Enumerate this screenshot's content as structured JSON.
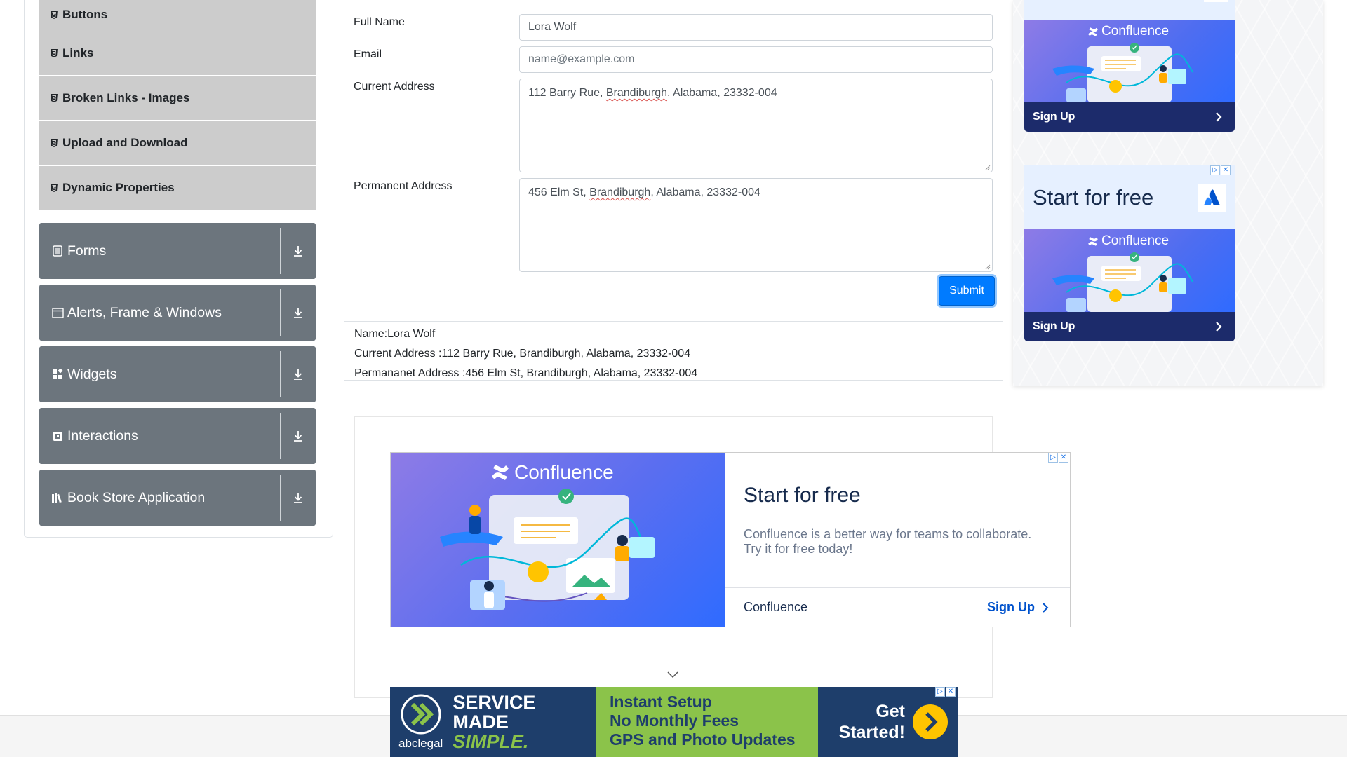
{
  "sidebar": {
    "elements_items": [
      {
        "label": "Buttons"
      },
      {
        "label": "Links"
      },
      {
        "label": "Broken Links - Images"
      },
      {
        "label": "Upload and Download"
      },
      {
        "label": "Dynamic Properties"
      }
    ],
    "groups": [
      {
        "label": "Forms",
        "icon": "form-icon"
      },
      {
        "label": "Alerts, Frame & Windows",
        "icon": "window-icon"
      },
      {
        "label": "Widgets",
        "icon": "widgets-icon"
      },
      {
        "label": "Interactions",
        "icon": "interactions-icon"
      },
      {
        "label": "Book Store Application",
        "icon": "books-icon"
      }
    ]
  },
  "form": {
    "full_name_label": "Full Name",
    "full_name_value": "Lora Wolf",
    "email_label": "Email",
    "email_placeholder": "name@example.com",
    "current_address_label": "Current Address",
    "current_address_pre": "112 Barry Rue, ",
    "current_address_city": "Brandiburgh",
    "current_address_post": ", Alabama, 23332-004",
    "permanent_address_label": "Permanent Address",
    "permanent_address_pre": "456 Elm St, ",
    "permanent_address_city": "Brandiburgh",
    "permanent_address_post": ", Alabama, 23332-004",
    "submit_label": "Submit"
  },
  "output": {
    "name": "Name:Lora Wolf",
    "current_address": "Current Address :112 Barry Rue, Brandiburgh, Alabama, 23332-004",
    "permanent_address": "Permananet Address :456 Elm St, Brandiburgh, Alabama, 23332-004"
  },
  "ads": {
    "brand": "Confluence",
    "signup": "Sign Up",
    "start_for_free": "Start for free",
    "main_title": "Start for free",
    "main_body": "Confluence is a better way for teams to collaborate. Try it for free today!",
    "main_brand": "Confluence",
    "main_signup": "Sign Up",
    "banner_brand": "abclegal",
    "banner_slogan_1": "SERVICE",
    "banner_slogan_2": "MADE",
    "banner_slogan_3": "SIMPLE.",
    "banner_line_1": "Instant Setup",
    "banner_line_2": "No Monthly Fees",
    "banner_line_3": "GPS and Photo Updates",
    "banner_cta_1": "Get",
    "banner_cta_2": "Started!"
  },
  "colors": {
    "sidebar_group_bg": "#6c757d",
    "sidebar_item_bg": "#cccccc",
    "primary": "#007bff",
    "ad_navy": "#1c2b6b",
    "banner_green": "#8bc34a"
  }
}
